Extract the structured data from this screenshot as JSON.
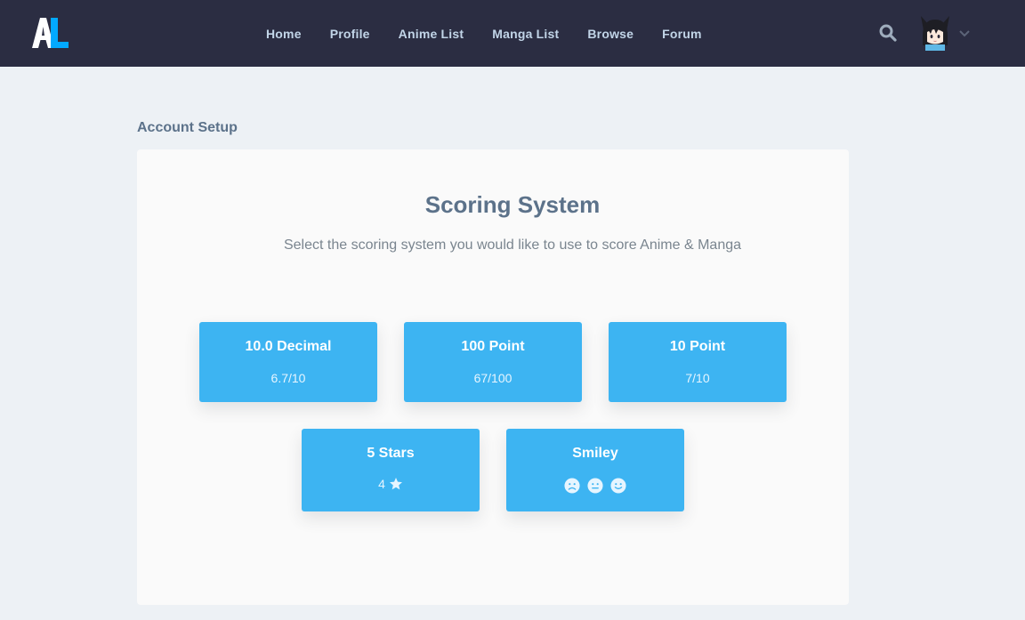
{
  "nav": {
    "links": [
      "Home",
      "Profile",
      "Anime List",
      "Manga List",
      "Browse",
      "Forum"
    ]
  },
  "page": {
    "section_title": "Account Setup",
    "heading": "Scoring System",
    "subheading": "Select the scoring system you would like to use to score Anime & Manga"
  },
  "options": [
    {
      "title": "10.0 Decimal",
      "example": "6.7/10"
    },
    {
      "title": "100 Point",
      "example": "67/100"
    },
    {
      "title": "10 Point",
      "example": "7/10"
    },
    {
      "title": "5 Stars",
      "example": "4"
    },
    {
      "title": "Smiley",
      "example": ""
    }
  ],
  "icons": {
    "logo": "anilist-logo-icon",
    "search": "search-icon",
    "chevron": "chevron-down-icon",
    "star": "star-icon",
    "smileys": [
      "frown-icon",
      "neutral-icon",
      "smile-icon"
    ]
  },
  "colors": {
    "nav_bg": "#2b2d42",
    "accent": "#3db4f2",
    "page_bg": "#edf1f5"
  }
}
